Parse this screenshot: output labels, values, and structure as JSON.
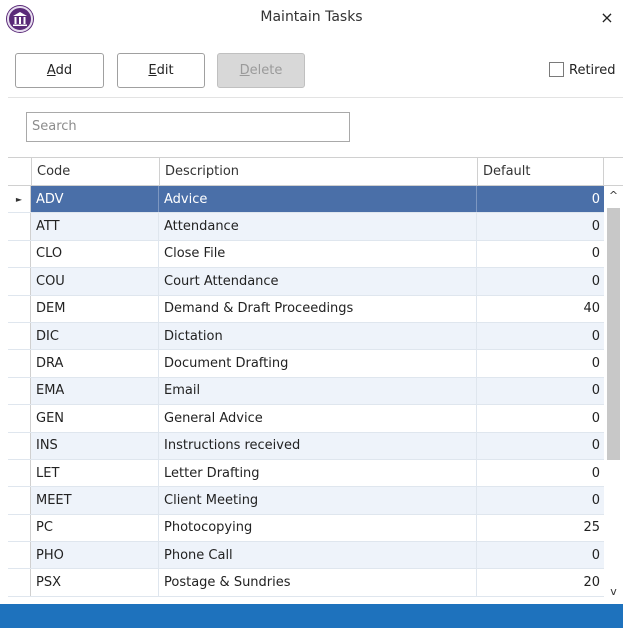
{
  "window": {
    "title": "Maintain Tasks",
    "close_glyph": "×",
    "logo_icon": "columns-building-icon"
  },
  "toolbar": {
    "add": {
      "first": "A",
      "rest": "dd"
    },
    "edit": {
      "first": "E",
      "rest": "dit"
    },
    "delete": {
      "first": "D",
      "rest": "elete"
    },
    "retired_label": "Retired"
  },
  "search": {
    "placeholder": "Search"
  },
  "grid": {
    "columns": {
      "code": "Code",
      "description": "Description",
      "default": "Default"
    },
    "rows": [
      {
        "code": "ADV",
        "description": "Advice",
        "default": "0"
      },
      {
        "code": "ATT",
        "description": "Attendance",
        "default": "0"
      },
      {
        "code": "CLO",
        "description": "Close File",
        "default": "0"
      },
      {
        "code": "COU",
        "description": "Court Attendance",
        "default": "0"
      },
      {
        "code": "DEM",
        "description": "Demand & Draft Proceedings",
        "default": "40"
      },
      {
        "code": "DIC",
        "description": "Dictation",
        "default": "0"
      },
      {
        "code": "DRA",
        "description": "Document Drafting",
        "default": "0"
      },
      {
        "code": "EMA",
        "description": "Email",
        "default": "0"
      },
      {
        "code": "GEN",
        "description": "General Advice",
        "default": "0"
      },
      {
        "code": "INS",
        "description": "Instructions received",
        "default": "0"
      },
      {
        "code": "LET",
        "description": "Letter Drafting",
        "default": "0"
      },
      {
        "code": "MEET",
        "description": "Client Meeting",
        "default": "0"
      },
      {
        "code": "PC",
        "description": "Photocopying",
        "default": "25"
      },
      {
        "code": "PHO",
        "description": "Phone Call",
        "default": "0"
      },
      {
        "code": "PSX",
        "description": "Postage & Sundries",
        "default": "20"
      }
    ],
    "selected_index": 0,
    "row_indicator": "►",
    "scroll_up": "^",
    "scroll_down": "v"
  },
  "colors": {
    "selection": "#4a6fa8",
    "statusbar": "#1e72bd",
    "logo": "#5a2a78"
  }
}
